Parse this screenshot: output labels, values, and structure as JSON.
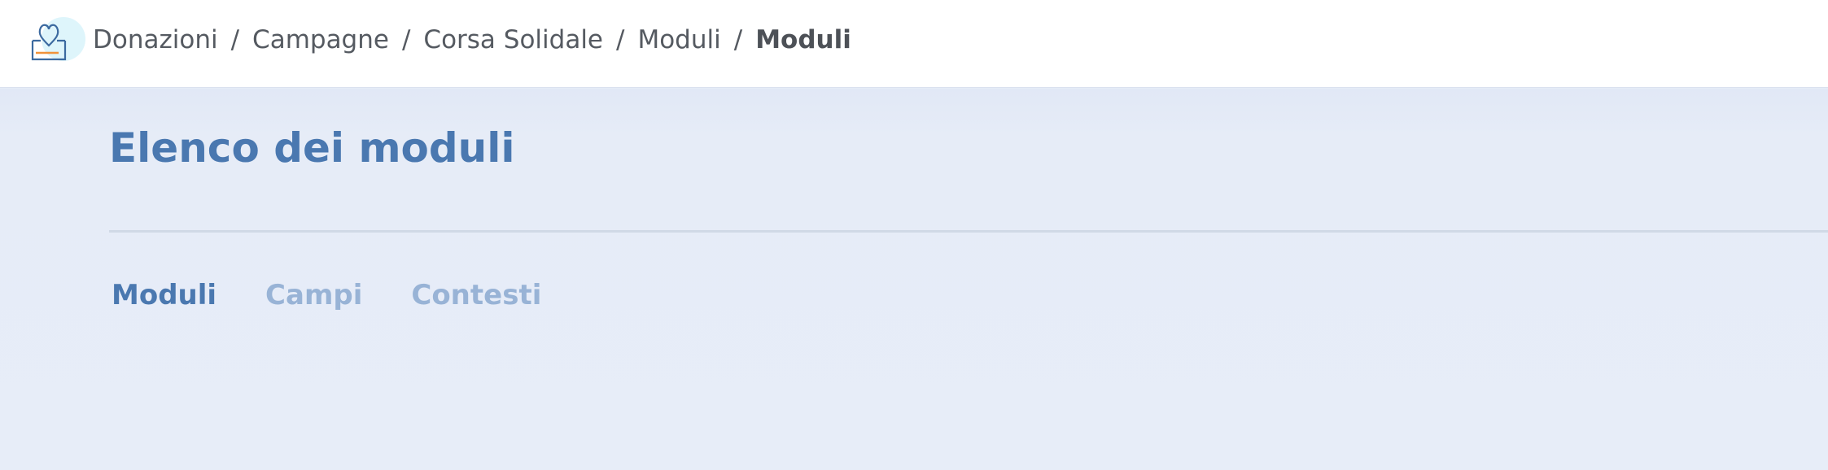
{
  "breadcrumb": {
    "items": [
      "Donazioni",
      "Campagne",
      "Corsa Solidale",
      "Moduli"
    ],
    "current": "Moduli",
    "separator": "/"
  },
  "logo": {
    "icon": "donation-box-heart-icon"
  },
  "page": {
    "title": "Elenco dei moduli"
  },
  "tabs": [
    {
      "label": "Moduli",
      "active": true
    },
    {
      "label": "Campi",
      "active": false
    },
    {
      "label": "Contesti",
      "active": false
    }
  ],
  "colors": {
    "accent": "#4a78b0",
    "tab_inactive": "#98b3d6",
    "background": "#e6ecf7",
    "breadcrumb_text": "#555a61"
  }
}
